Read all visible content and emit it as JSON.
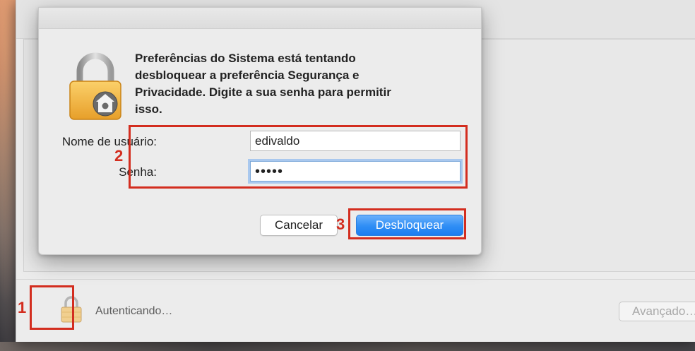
{
  "dialog": {
    "message": "Preferências do Sistema está tentando\ndesbloquear a preferência Segurança e\nPrivacidade. Digite a sua senha para permitir\nisso.",
    "username_label": "Nome de usuário:",
    "username_value": "edivaldo",
    "password_label": "Senha:",
    "password_value": "•••••",
    "cancel_label": "Cancelar",
    "unlock_label": "Desbloquear",
    "icon": "padlock-with-gear-icon"
  },
  "window": {
    "status_text": "Autenticando…",
    "advanced_label": "Avançado…",
    "lock_icon": "padlock-icon"
  },
  "annotations": {
    "step1": "1",
    "step2": "2",
    "step3": "3",
    "color": "#d32d1f"
  },
  "colors": {
    "unlock_button": "#2f8ef5",
    "focus_ring": "#a9c8ee"
  }
}
